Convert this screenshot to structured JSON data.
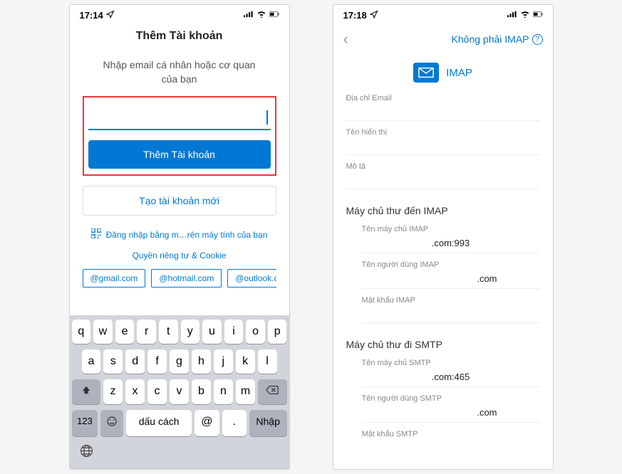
{
  "screen1": {
    "status": {
      "time": "17:14",
      "nav_icon": "✈"
    },
    "title": "Thêm Tài khoản",
    "subtitle": "Nhập email cá nhân hoặc cơ quan của bạn",
    "email_value": "",
    "btn_add": "Thêm Tài khoản",
    "btn_create": "Tạo tài khoản mới",
    "qr_text": "Đăng nhập bằng m…rên máy tính của bạn",
    "privacy": "Quyền riêng tư & Cookie",
    "domains": [
      "@gmail.com",
      "@hotmail.com",
      "@outlook.com"
    ],
    "keyboard": {
      "row1": [
        "q",
        "w",
        "e",
        "r",
        "t",
        "y",
        "u",
        "i",
        "o",
        "p"
      ],
      "row2": [
        "a",
        "s",
        "d",
        "f",
        "g",
        "h",
        "j",
        "k",
        "l"
      ],
      "row3": [
        "z",
        "x",
        "c",
        "v",
        "b",
        "n",
        "m"
      ],
      "num": "123",
      "space": "dấu cách",
      "at": "@",
      "dot": ".",
      "return": "Nhập"
    }
  },
  "screen2": {
    "status": {
      "time": "17:18",
      "nav_icon": "✈"
    },
    "nav_link": "Không phải IMAP",
    "imap_title": "IMAP",
    "fields": {
      "email_label": "Địa chỉ Email",
      "display_label": "Tên hiển thị",
      "desc_label": "Mô tả"
    },
    "imap_section": {
      "title": "Máy chủ thư đến IMAP",
      "host_label": "Tên máy chủ IMAP",
      "host_value": ".com:993",
      "user_label": "Tên người dùng IMAP",
      "user_value": ".com",
      "pass_label": "Mật khẩu IMAP"
    },
    "smtp_section": {
      "title": "Máy chủ thư đi SMTP",
      "host_label": "Tên máy chủ SMTP",
      "host_value": ".com:465",
      "user_label": "Tên người dùng SMTP",
      "user_value": ".com",
      "pass_label": "Mật khẩu SMTP"
    }
  }
}
